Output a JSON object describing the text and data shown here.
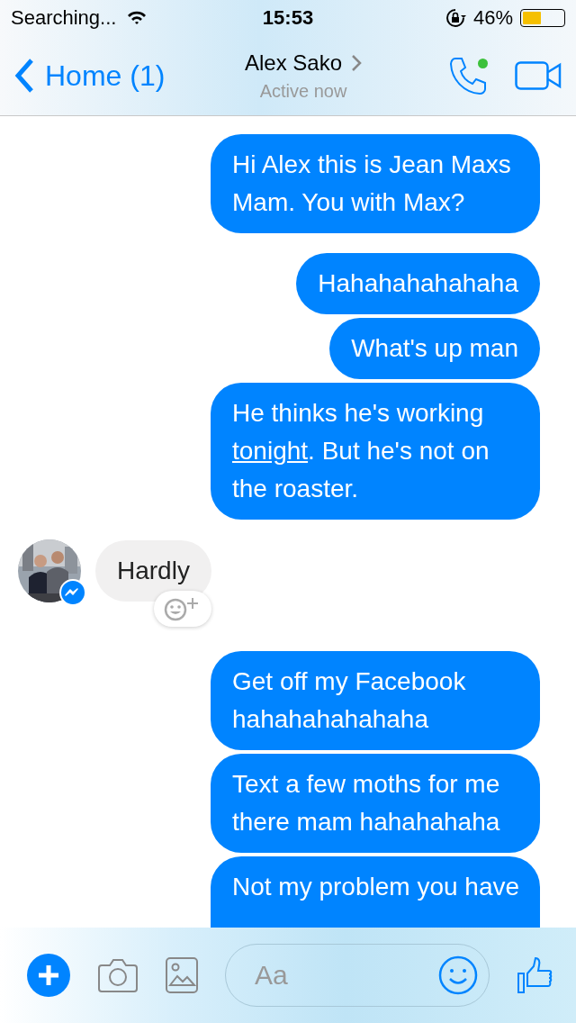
{
  "status_bar": {
    "carrier": "Searching...",
    "time": "15:53",
    "battery_text": "46%",
    "battery": {
      "level": 0.46
    }
  },
  "header": {
    "back_label": "Home (1)",
    "title": "Alex Sako",
    "subtitle": "Active now",
    "online": true
  },
  "groups": [
    {
      "kind": "outgoing",
      "messages": [
        {
          "parts": [
            {
              "text": "Hi Alex this is Jean Maxs Mam. You with Max?"
            }
          ]
        }
      ]
    },
    {
      "kind": "outgoing",
      "messages": [
        {
          "parts": [
            {
              "text": "Hahahahahahaha"
            }
          ]
        },
        {
          "parts": [
            {
              "text": "What's up man"
            }
          ]
        },
        {
          "parts": [
            {
              "text": "He thinks he's working "
            },
            {
              "text": "tonight",
              "link": true
            },
            {
              "text": ". But he's not on the roaster."
            }
          ]
        }
      ]
    },
    {
      "kind": "incoming",
      "messages": [
        {
          "parts": [
            {
              "text": "Hardly"
            }
          ]
        }
      ]
    },
    {
      "kind": "outgoing",
      "messages": [
        {
          "parts": [
            {
              "text": "Get off my Facebook hahahahahahaha"
            }
          ]
        },
        {
          "parts": [
            {
              "text": "Text a few moths for me there mam hahahahaha"
            }
          ]
        },
        {
          "parts": [
            {
              "text": "Not my problem you have"
            }
          ],
          "cut": true
        }
      ]
    }
  ],
  "composer": {
    "placeholder": "Aa"
  }
}
